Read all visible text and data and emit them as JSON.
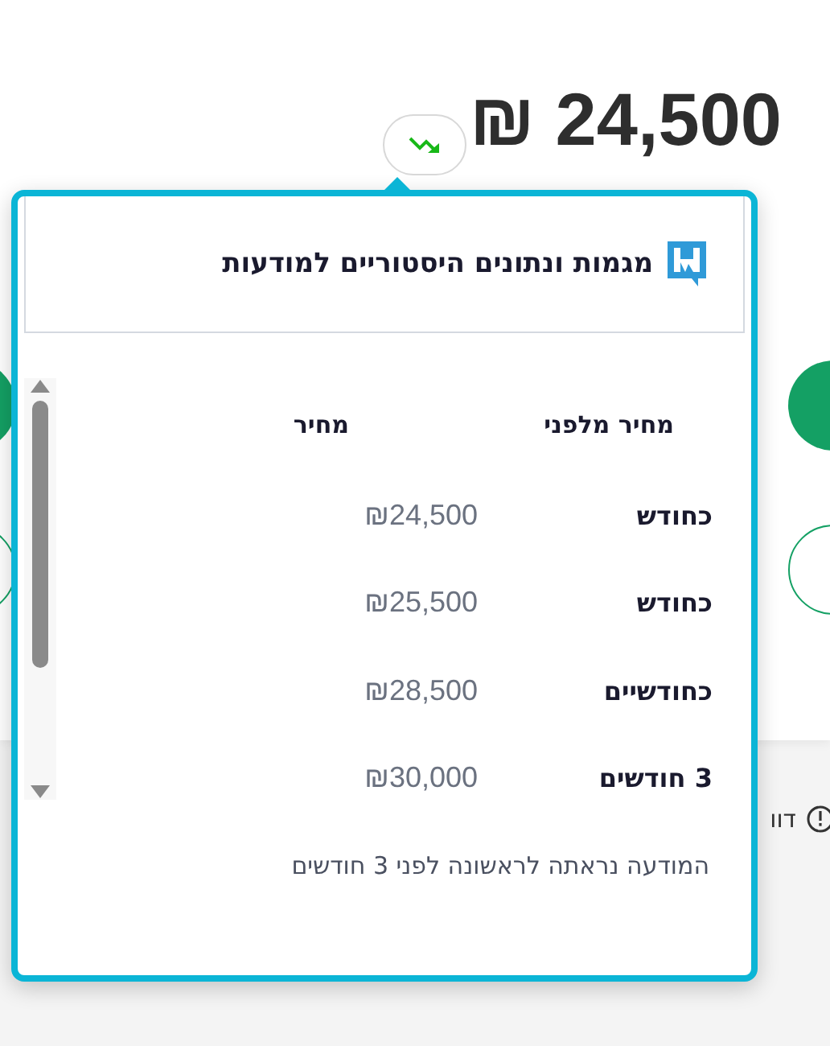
{
  "price": {
    "amount": "₪ 24,500",
    "trend": {
      "kind": "down"
    }
  },
  "notice": {
    "text": "דוו"
  },
  "popup": {
    "title": "מגמות ונתונים היסטוריים למודעות",
    "columns": [
      "מחיר מלפני",
      "מחיר"
    ],
    "rows": [
      {
        "period": "כחודש",
        "price": "₪24,500"
      },
      {
        "period": "כחודש",
        "price": "₪25,500"
      },
      {
        "period": "כחודשיים",
        "price": "₪28,500"
      },
      {
        "period": "3 חודשים",
        "price": "₪30,000"
      }
    ],
    "note": "המודעה נראתה לראשונה לפני 3 חודשים"
  }
}
